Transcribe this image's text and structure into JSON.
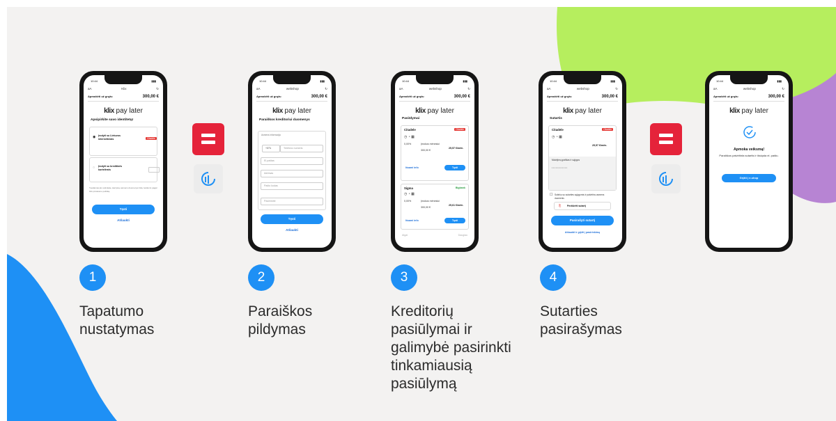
{
  "colors": {
    "blue": "#1e90f5",
    "green": "#b6ee5e",
    "purple": "#b784d3",
    "red": "#e5233a"
  },
  "common": {
    "time": "10:44",
    "amount_label": "Apmokėti už grąžu",
    "amount": "300,00 €",
    "brand_bold": "klix",
    "brand_rest": " pay later",
    "next": "Tęsti"
  },
  "phones": [
    {
      "url": "Klix",
      "heading": "Apsipirkite savo identitetą!",
      "option1": "Įrodyti su Lietuvos internetiniais",
      "badge1": "Citadele",
      "option2": "Įrodyti su kreditinės kortelėmis",
      "fineprint": "Tęsdamas jūs sutinkate, kad jūsų asmens duomenys būtų tvarkomi pagal Klix privatumo politiką.",
      "cta": "Tęsti",
      "link": "Atšaukti"
    },
    {
      "url": "webshop",
      "heading": "Paraiškos kreditoriui duomenys",
      "section": "Asmens informacija",
      "fields": [
        "Telefono numeris",
        "El.paštas",
        "Adresas",
        "Pašto kodas"
      ],
      "phone_prefix": "+371",
      "select_label": "Pasirinkite",
      "cta": "Tęsti",
      "link": "Atšaukti"
    },
    {
      "url": "webshop",
      "heading": "Pasiūlymai",
      "offers": [
        {
          "name": "Citadele",
          "badge": "Citadele",
          "term": "Įmokos mėnesiui",
          "rate": "0,00%",
          "sum": "300,00 €",
          "monthly": "25,57 €/mėn.",
          "details": "Išsami info",
          "cta": "Tęsti"
        },
        {
          "name": "Sigma",
          "badge": "Bigbank",
          "term": "Įmokos mėnesiui",
          "rate": "0,00%",
          "sum": "300,00 €",
          "monthly": "25,61 €/mėn.",
          "details": "Išsami info",
          "cta": "Tęsti"
        }
      ],
      "footer_left": "Atgal",
      "footer_right": "Daugiau"
    },
    {
      "url": "webshop",
      "heading": "Sutartis",
      "offer_name": "Citadele",
      "badge": "Citadele",
      "monthly": "25,57 €/mėn.",
      "summary": "Mokėjimų grafikas ir sąlygos",
      "consent": "Sutinku su sutarties sąlygomis ir patvirtinu asmens duomenis",
      "doc_link": "Peržiūrėti sutartį",
      "cta": "Pasirašyti sutartį",
      "link": "Atšaukti ir grįžti į pasirinkimą"
    },
    {
      "url": "webshop",
      "heading": "Apmoka veiksmą!",
      "body": "Paraiškos patvirtinta sutartis ir išsiųsta el. paštu.",
      "cta": "Grįžti į e-shop"
    }
  ],
  "steps": [
    {
      "num": "1",
      "lines": [
        "Tapatumo",
        "nustatymas"
      ]
    },
    {
      "num": "2",
      "lines": [
        "Paraiškos",
        "pildymas"
      ]
    },
    {
      "num": "3",
      "lines": [
        "Kreditorių",
        "pasiūlymai ir",
        "galimybė pasirinkti",
        "tinkamiausią",
        "pasiūlymą"
      ]
    },
    {
      "num": "4",
      "lines": [
        "Sutarties",
        "pasirašymas"
      ]
    }
  ]
}
